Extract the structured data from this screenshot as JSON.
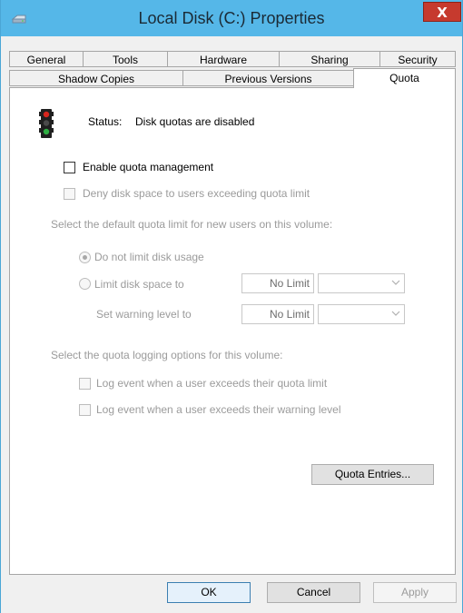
{
  "window": {
    "title": "Local Disk (C:) Properties",
    "close_label": "X",
    "accent": "#55b7e8",
    "close_color": "#c63a2e"
  },
  "tabs": {
    "row1": [
      "General",
      "Tools",
      "Hardware",
      "Sharing",
      "Security"
    ],
    "row2": [
      "Shadow Copies",
      "Previous Versions",
      "Quota"
    ],
    "active": "Quota"
  },
  "quota": {
    "status_label": "Status:",
    "status_value": "Disk quotas are disabled",
    "enable_label": "Enable quota management",
    "enable_checked": false,
    "deny_label": "Deny disk space to users exceeding quota limit",
    "deny_checked": false,
    "default_limit_heading": "Select the default quota limit for new users on this volume:",
    "no_limit_option": "Do not limit disk usage",
    "limit_option": "Limit disk space to",
    "selected_option": "Do not limit disk usage",
    "limit_value": "No Limit",
    "warning_label": "Set warning level to",
    "warning_value": "No Limit",
    "logging_heading": "Select the quota logging options for this volume:",
    "log_limit_label": "Log event when a user exceeds their quota limit",
    "log_limit_checked": false,
    "log_warning_label": "Log event when a user exceeds their warning level",
    "log_warning_checked": false,
    "entries_button": "Quota Entries..."
  },
  "footer": {
    "ok": "OK",
    "cancel": "Cancel",
    "apply": "Apply"
  },
  "icons": {
    "title": "drive-icon",
    "status": "traffic-light-icon",
    "close": "close-icon"
  }
}
